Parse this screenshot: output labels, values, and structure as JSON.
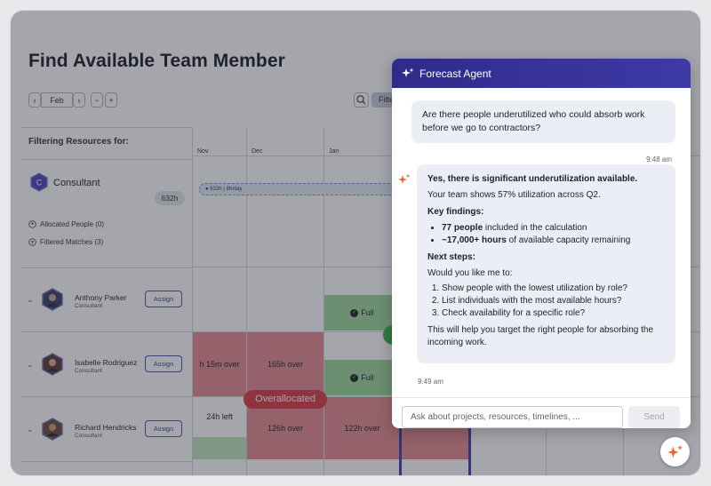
{
  "page": {
    "title": "Find Available Team Member"
  },
  "toolbar": {
    "month": "Feb",
    "prev_glyph": "‹",
    "next_glyph": "›",
    "zoom_out_glyph": "−",
    "zoom_in_glyph": "+",
    "filters_label": "Filte"
  },
  "left": {
    "filtering_label": "Filtering Resources for:",
    "role_initial": "C",
    "role_name": "Consultant",
    "role_hours": "632h",
    "allocated_people": "Allocated People (0)",
    "filtered_matches": "Filtered Matches (3)",
    "assign_label": "Assign",
    "people": [
      {
        "name": "Anthony Parker",
        "role": "Consultant"
      },
      {
        "name": "Isabelle Rodriguez",
        "role": "Consultant"
      },
      {
        "name": "Richard Hendricks",
        "role": "Consultant"
      }
    ]
  },
  "grid": {
    "months": [
      "Nov",
      "Dec",
      "Jan"
    ],
    "demand_bar": "632h | 8h/day",
    "cells": {
      "r1_full": "Full",
      "r2_over1": "h 15m over",
      "r2_over2": "165h over",
      "r2_full": "Full",
      "r3_left": "24h left",
      "r3_over1": "126h over",
      "r3_over2": "122h over"
    },
    "overallocated": "Overallocated"
  },
  "agent": {
    "header_title": "Forecast Agent",
    "user_message": "Are there people underutilized who could absorb work before we go to contractors?",
    "user_time": "9:48 am",
    "reply_heading": "Yes, there is significant underutilization available.",
    "reply_intro": "Your team shows 57% utilization across Q2.",
    "findings_heading": "Key findings:",
    "finding1_bold": "77 people",
    "finding1_rest": " included in the calculation",
    "finding2_bold": "~17,000+ hours",
    "finding2_rest": " of available capacity remaining",
    "next_heading": "Next steps:",
    "next_intro": "Would you like me to:",
    "steps": [
      "Show people with the lowest utilization by role?",
      "List individuals with the most available hours?",
      "Check availability for a specific role?"
    ],
    "closing": "This will help you target the right people for absorbing the incoming work.",
    "reply_time": "9:49 am",
    "input_placeholder": "Ask about projects, resources, timelines, ...",
    "send_label": "Send"
  },
  "colors": {
    "brand": "#3e3aa6",
    "over": "#e48a8f",
    "full": "#9fd89a",
    "alert": "#d83b45",
    "accent_spark": "#f0652e"
  }
}
